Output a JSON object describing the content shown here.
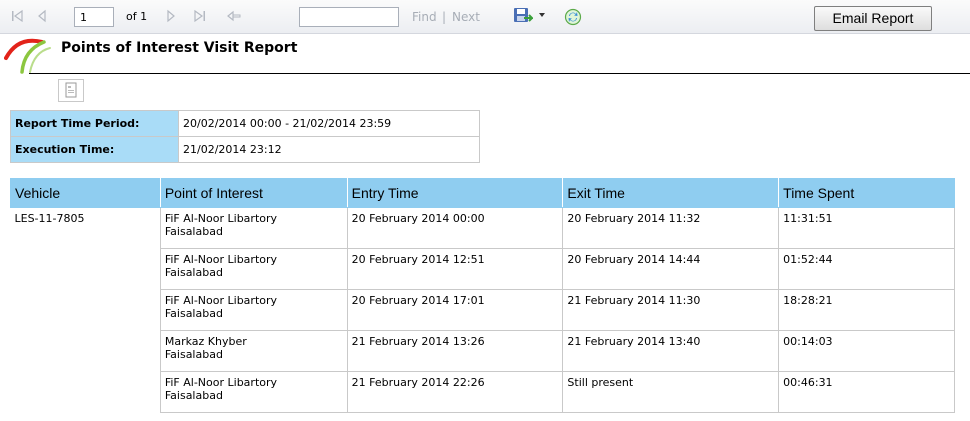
{
  "toolbar": {
    "page_current": "1",
    "page_of": "of 1",
    "find_value": "",
    "find_label": "Find",
    "find_separator": "|",
    "next_label": "Next",
    "email_label": "Email Report",
    "icons": [
      "first-page-icon",
      "previous-page-icon",
      "next-page-icon",
      "last-page-icon",
      "back-icon",
      "export-save-icon",
      "dropdown-icon",
      "refresh-icon"
    ]
  },
  "header": {
    "title": "Points of Interest Visit Report",
    "logo": "arc-logo"
  },
  "info": [
    {
      "label": "Report Time Period:",
      "value": "20/02/2014 00:00 - 21/02/2014 23:59"
    },
    {
      "label": "Execution Time:",
      "value": "21/02/2014 23:12"
    }
  ],
  "table": {
    "columns": [
      "Vehicle",
      "Point of Interest",
      "Entry Time",
      "Exit Time",
      "Time Spent"
    ],
    "rows": [
      {
        "vehicle": "LES-11-7805",
        "poi_line1": "FiF Al-Noor Libartory",
        "poi_line2": "Faisalabad",
        "entry": "20 February 2014 00:00",
        "exit": "20 February 2014 11:32",
        "spent": "11:31:51"
      },
      {
        "vehicle": "",
        "poi_line1": "FiF Al-Noor Libartory",
        "poi_line2": "Faisalabad",
        "entry": "20 February 2014 12:51",
        "exit": "20 February 2014 14:44",
        "spent": "01:52:44"
      },
      {
        "vehicle": "",
        "poi_line1": "FiF Al-Noor Libartory",
        "poi_line2": "Faisalabad",
        "entry": "20 February 2014 17:01",
        "exit": "21 February 2014 11:30",
        "spent": "18:28:21"
      },
      {
        "vehicle": "",
        "poi_line1": "Markaz Khyber",
        "poi_line2": "Faisalabad",
        "entry": "21 February 2014 13:26",
        "exit": "21 February 2014 13:40",
        "spent": "00:14:03"
      },
      {
        "vehicle": "",
        "poi_line1": "FiF Al-Noor Libartory",
        "poi_line2": "Faisalabad",
        "entry": "21 February 2014 22:26",
        "exit": "Still present",
        "spent": "00:46:31"
      }
    ]
  },
  "colors": {
    "header_bg": "#8fcdf0",
    "label_bg": "#a9dcf7",
    "logo_red": "#e2231a",
    "logo_green": "#8cc63f"
  }
}
